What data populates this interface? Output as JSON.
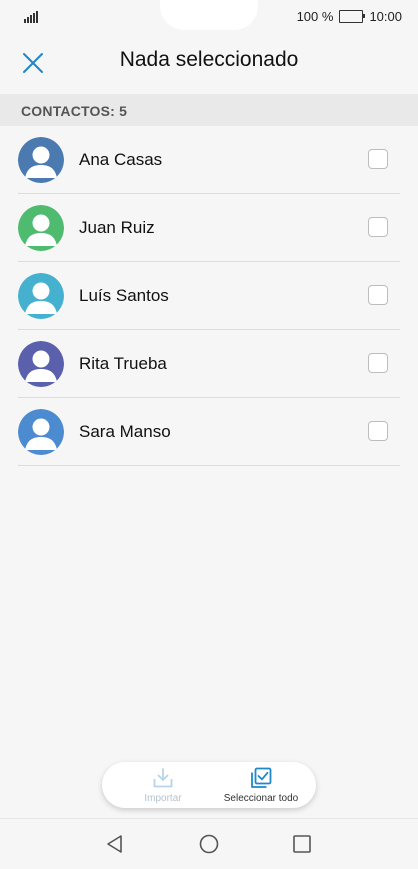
{
  "status_bar": {
    "battery": "100 %",
    "time": "10:00"
  },
  "header": {
    "title": "Nada seleccionado",
    "close_icon": "close-icon"
  },
  "section": {
    "label": "CONTACTOS: 5"
  },
  "contacts": [
    {
      "name": "Ana Casas",
      "color": "#4a7ab0",
      "checked": false
    },
    {
      "name": "Juan Ruiz",
      "color": "#4fbb6f",
      "checked": false
    },
    {
      "name": "Luís Santos",
      "color": "#45b1cf",
      "checked": false
    },
    {
      "name": "Rita Trueba",
      "color": "#5b60ac",
      "checked": false
    },
    {
      "name": "Sara Manso",
      "color": "#4d8bd0",
      "checked": false
    }
  ],
  "actions": {
    "import_label": "Importar",
    "select_all_label": "Seleccionar todo"
  },
  "colors": {
    "accent": "#1e88c9",
    "disabled": "#b7d4ea"
  }
}
